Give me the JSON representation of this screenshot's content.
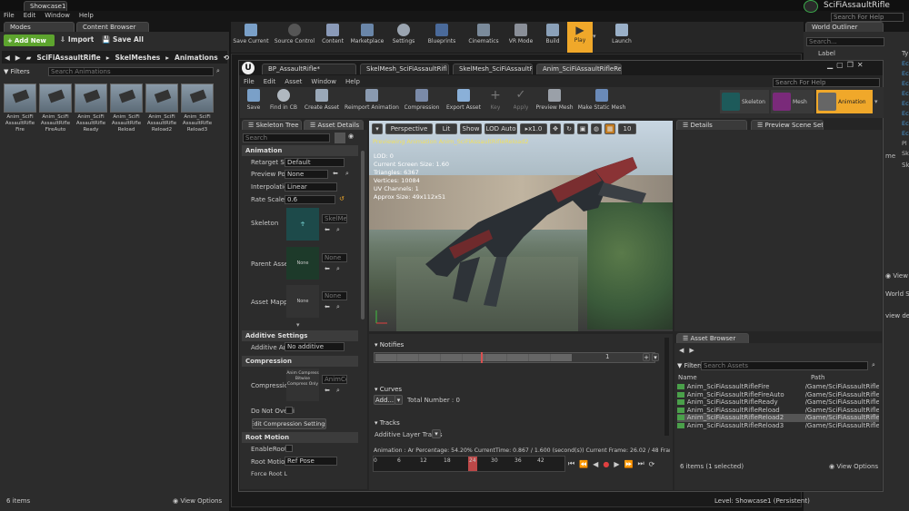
{
  "window": {
    "app_tab": "Showcase1*",
    "project_name": "SciFiAssaultRifle",
    "search_help": "Search For Help"
  },
  "main_menu": [
    "File",
    "Edit",
    "Window",
    "Help"
  ],
  "modes_tab": "Modes",
  "content_browser": {
    "tab": "Content Browser",
    "add_new": "Add New",
    "import": "Import",
    "save_all": "Save All",
    "path": [
      "SciFiAssaultRifle",
      "SkelMeshes",
      "Animations"
    ],
    "filters": "Filters",
    "search_placeholder": "Search Animations",
    "assets": [
      {
        "name": "Anim_SciFi AssaultRifle Fire"
      },
      {
        "name": "Anim_SciFi AssaultRifle FireAuto"
      },
      {
        "name": "Anim_SciFi AssaultRifle Ready"
      },
      {
        "name": "Anim_SciFi AssaultRifle Reload"
      },
      {
        "name": "Anim_SciFi AssaultRifle Reload2"
      },
      {
        "name": "Anim_SciFi AssaultRifle Reload3"
      }
    ],
    "item_count": "6 items",
    "view_options": "View Options"
  },
  "level_toolbar": [
    "Save Current",
    "Source Control",
    "Content",
    "Marketplace",
    "Settings",
    "Blueprints",
    "Cinematics",
    "VR Mode",
    "Build",
    "Play",
    "Launch"
  ],
  "world_outliner": {
    "tab": "World Outliner",
    "search": "Search...",
    "label_col": "Label",
    "type_col": "Ty"
  },
  "editor": {
    "tabs": [
      "BP_AssaultRifle*",
      "SkelMesh_SciFiAssaultRifl",
      "SkelMesh_SciFiAssaultRifl",
      "Anim_SciFiAssaultRifleRel"
    ],
    "menu": [
      "File",
      "Edit",
      "Asset",
      "Window",
      "Help"
    ],
    "search_help": "Search For Help",
    "toolbar": [
      "Save",
      "Find in CB",
      "Create Asset",
      "Reimport Animation",
      "Compression",
      "Export Asset",
      "Key",
      "Apply",
      "Preview Mesh",
      "Make Static Mesh"
    ],
    "modes": [
      "Skeleton",
      "Mesh",
      "Animation"
    ],
    "skeleton_tree_tab": "Skeleton Tree",
    "asset_details_tab": "Asset Details",
    "details_tab": "Details",
    "preview_scene_tab": "Preview Scene Setti",
    "details_search": "Search",
    "animation_section": "Animation",
    "props": {
      "retarget_label": "Retarget Sou",
      "retarget_value": "Default",
      "preview_pose_label": "Preview Pos",
      "preview_pose_value": "None",
      "interpolation_label": "Interpolation",
      "interpolation_value": "Linear",
      "rate_scale_label": "Rate Scale",
      "rate_scale_value": "0.6",
      "skeleton_label": "Skeleton",
      "skeleton_value": "SkelMe",
      "parent_asset_label": "Parent Asset",
      "parent_asset_thumb": "None",
      "parent_asset_value": "None",
      "asset_mapping_label": "Asset Mappi",
      "asset_mapping_thumb": "None",
      "asset_mapping_value": "None"
    },
    "additive_section": "Additive Settings",
    "additive_label": "Additive Ani",
    "additive_value": "No additive",
    "compression_section": "Compression",
    "compression_label": "Compression",
    "compression_thumb": "Anim Compress Bitwise Compress Only",
    "compression_value": "AnimCo",
    "do_not_override": "Do Not Overri",
    "edit_compression": "Edit Compression Settings",
    "root_motion_section": "Root Motion",
    "enable_root": "EnableRootM",
    "root_motion_label": "Root Motion",
    "root_motion_value": "Ref Pose",
    "force_root": "Force Root L"
  },
  "viewport": {
    "perspective": "Perspective",
    "lit": "Lit",
    "show": "Show",
    "lod": "LOD Auto",
    "speed": "x1.0",
    "grid_value": "10",
    "previewing": "Previewing Animation Anim_SciFiAssaultRifleReload2",
    "stats": [
      "LOD: 0",
      "Current Screen Size: 1.60",
      "Triangles: 6367",
      "Vertices: 10084",
      "UV Channels: 1",
      "Approx Size: 49x112x51"
    ]
  },
  "timeline": {
    "notifies": "Notifies",
    "track_index": "1",
    "curves": "Curves",
    "add": "Add...",
    "total_number": "Total Number : 0",
    "tracks": "Tracks",
    "additive_layer": "Additive Layer Tracks",
    "status": "Animation : Ar Percentage: 54.20% CurrentTime: 0.867 / 1.600 (second(s)) Current Frame: 26.02 / 48 Frame",
    "ticks": [
      "0",
      "6",
      "12",
      "18",
      "24",
      "30",
      "36",
      "42"
    ],
    "current_frame": "26"
  },
  "asset_browser": {
    "tab": "Asset Browser",
    "filters": "Filters",
    "search_placeholder": "Search Assets",
    "name_col": "Name",
    "path_col": "Path",
    "rows": [
      {
        "name": "Anim_SciFiAssaultRifleFire",
        "path": "/Game/SciFiAssaultRifle/"
      },
      {
        "name": "Anim_SciFiAssaultRifleFireAuto",
        "path": "/Game/SciFiAssaultRifle/"
      },
      {
        "name": "Anim_SciFiAssaultRifleReady",
        "path": "/Game/SciFiAssaultRifle/"
      },
      {
        "name": "Anim_SciFiAssaultRifleReload",
        "path": "/Game/SciFiAssaultRifle/"
      },
      {
        "name": "Anim_SciFiAssaultRifleReload2",
        "path": "/Game/SciFiAssaultRifle/"
      },
      {
        "name": "Anim_SciFiAssaultRifleReload3",
        "path": "/Game/SciFiAssaultRifle/"
      }
    ],
    "selection": "6 items (1 selected)",
    "view_options": "View Options"
  },
  "right_panel": {
    "items": [
      "Ec",
      "Ec",
      "Ec",
      "Ec",
      "Ec",
      "Ec",
      "Ec",
      "Ec",
      "Pl",
      "Sk",
      "me",
      "Sk"
    ],
    "view": "View",
    "world_settings": "World Set",
    "view_detail": "view detail"
  },
  "level_status": "Level:  Showcase1 (Persistent)",
  "colors": {
    "accent": "#f0a82a",
    "add_new": "#5da42e",
    "selected_row": "#555555",
    "timeline_marker": "#d85050"
  }
}
